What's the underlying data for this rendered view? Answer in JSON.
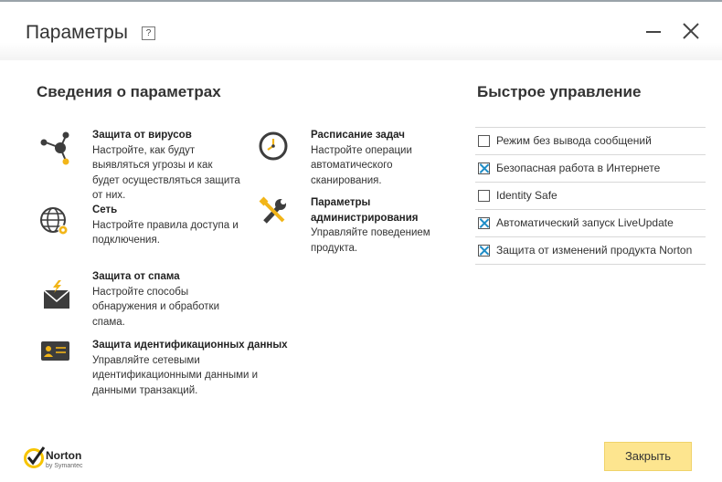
{
  "window": {
    "title": "Параметры",
    "help_label": "?"
  },
  "left_section": {
    "title": "Сведения о параметрах",
    "items": [
      {
        "icon": "virus-protection-icon",
        "title": "Защита от вирусов",
        "lines": [
          "Настройте, как будут",
          "выявляться угрозы и как",
          "будет осуществляться защита",
          "от них."
        ]
      },
      {
        "icon": "network-globe-icon",
        "title": "Сеть",
        "lines": [
          "Настройте правила доступа и",
          "подключения."
        ]
      },
      {
        "icon": "antispam-mail-icon",
        "title": "Защита от спама",
        "lines": [
          "Настройте способы",
          "обнаружения и обработки",
          "спама."
        ]
      },
      {
        "icon": "identity-card-icon",
        "title": "Защита идентификационных данных",
        "lines": [
          "Управляйте сетевыми",
          "идентификационными данными и",
          "данными транзакций."
        ]
      },
      {
        "icon": "clock-icon",
        "title": "Расписание задач",
        "lines": [
          "Настройте операции",
          "автоматического",
          "сканирования."
        ]
      },
      {
        "icon": "admin-tools-icon",
        "title_lines": [
          "Параметры",
          "администрирования"
        ],
        "lines": [
          "Управляйте поведением",
          "продукта."
        ]
      }
    ]
  },
  "quick_controls": {
    "title": "Быстрое управление",
    "items": [
      {
        "label": "Режим без вывода сообщений",
        "checked": false
      },
      {
        "label": "Безопасная работа в Интернете",
        "checked": true
      },
      {
        "label": "Identity Safe",
        "checked": false
      },
      {
        "label": "Автоматический запуск LiveUpdate",
        "checked": true
      },
      {
        "label": "Защита от изменений продукта Norton",
        "checked": true
      }
    ]
  },
  "footer": {
    "logo_text": "Norton",
    "logo_sub": "by Symantec",
    "close_label": "Закрыть"
  },
  "colors": {
    "accent_check": "#1f8dc7",
    "close_button_bg": "#fde58f",
    "icon_dark": "#3d3d3d",
    "icon_orange": "#f2b518",
    "logo_yellow": "#f7c400"
  }
}
